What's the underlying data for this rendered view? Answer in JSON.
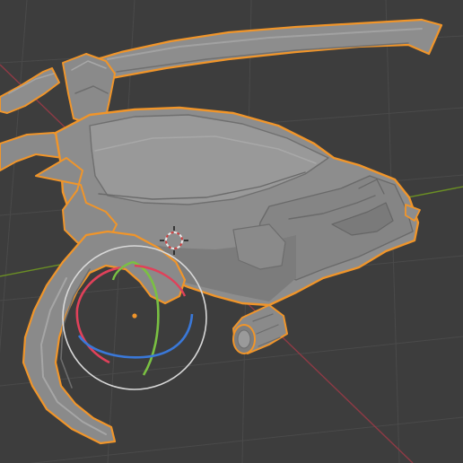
{
  "viewport": {
    "mode": "3d-viewport",
    "shading": "solid",
    "selection_outline": "orange"
  },
  "colors": {
    "background": "#3d3d3d",
    "grid_line": "#4a4a4a",
    "x_axis": "#8f3a45",
    "y_axis": "#6b8f24",
    "mesh_base": "#8d8d8d",
    "mesh_shadow": "#6f6f6f",
    "mesh_highlight": "#a2a2a2",
    "mesh_outline": "#f0952a",
    "gizmo_circle": "#d8d8d8",
    "gizmo_red": "#e0415a",
    "gizmo_green": "#7ac142",
    "gizmo_blue": "#3a78d8",
    "pivot": "#f0952a"
  },
  "gizmo": {
    "type": "rotate",
    "axes": [
      "X",
      "Y",
      "Z"
    ]
  },
  "icons": {
    "cursor": "3d-cursor-icon",
    "pivot": "origin-dot-icon"
  }
}
